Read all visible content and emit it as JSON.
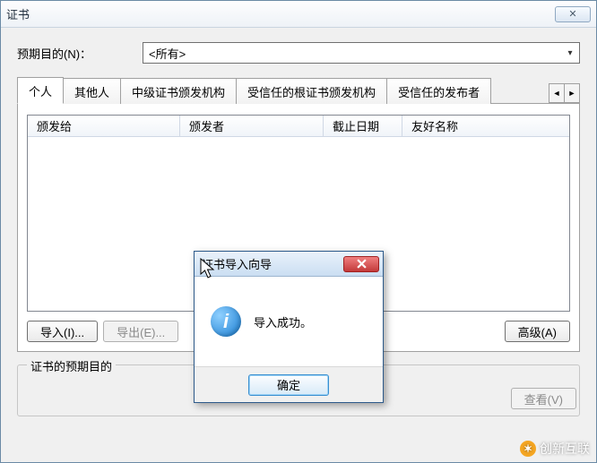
{
  "window": {
    "title": "证书",
    "close_glyph": "✕"
  },
  "purpose": {
    "label": "预期目的(N)：",
    "value": "<所有>"
  },
  "tabs": {
    "personal": "个人",
    "others": "其他人",
    "intermediate": "中级证书颁发机构",
    "trusted_root": "受信任的根证书颁发机构",
    "trusted_pub": "受信任的发布者",
    "scroll_left": "◄",
    "scroll_right": "►"
  },
  "columns": {
    "issued_to": "颁发给",
    "issued_by": "颁发者",
    "expiry": "截止日期",
    "friendly": "友好名称"
  },
  "buttons": {
    "import": "导入(I)...",
    "export": "导出(E)...",
    "remove": "",
    "advanced": "高级(A)",
    "view": "查看(V)"
  },
  "group": {
    "title": "证书的预期目的"
  },
  "msg": {
    "title": "证书导入向导",
    "text": "导入成功。",
    "ok": "确定",
    "icon_letter": "i"
  },
  "watermark": "创新互联"
}
